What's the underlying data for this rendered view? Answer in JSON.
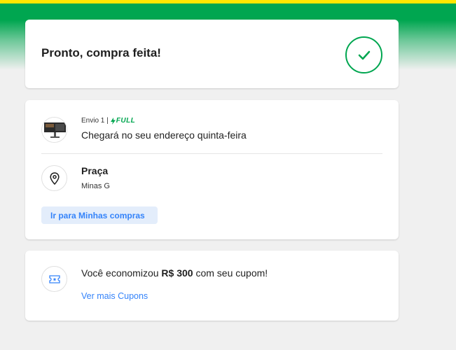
{
  "colors": {
    "brand_yellow": "#ffe600",
    "brand_green": "#00a650",
    "link_blue": "#3483fa",
    "button_bg": "#e3edfb",
    "page_bg": "#f0f0f0"
  },
  "success": {
    "title": "Pronto, compra feita!",
    "icon": "check-icon"
  },
  "shipment": {
    "thumbnail_icon": "product-thumbnail",
    "label": "Envio 1 |",
    "badge": "FULL",
    "badge_icon": "lightning-icon",
    "eta": "Chegará no seu endereço quinta-feira",
    "address_icon": "map-pin-icon",
    "address_street": "Praça",
    "address_city": "Minas G",
    "button_label": "Ir para Minhas compras"
  },
  "coupon": {
    "icon": "ticket-icon",
    "message_prefix": "Você economizou ",
    "amount": "R$ 300",
    "message_suffix": " com seu cupom!",
    "link_label": "Ver mais Cupons"
  }
}
